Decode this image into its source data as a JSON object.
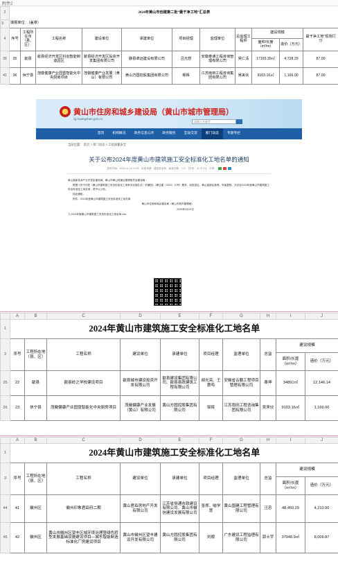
{
  "sheet1": {
    "tab_label": "附件2",
    "title": "2024年黄山市创建第二批“最干净工地”汇总表",
    "unit_label": "填报单位：（盖章）",
    "headers": {
      "seq": "序号",
      "county": "工程所在市（县、区）",
      "project": "工程名称",
      "builder": "建设单位",
      "contractor": "承建单位",
      "pm": "项目经理",
      "supervisor": "监理单位",
      "chief_supervisor": "总监理工程师",
      "scale": "建设规模",
      "area": "面积/长度（m²/m）",
      "cost": "造价（万元）",
      "score": "最干净工地”现场打分"
    },
    "rows": [
      {
        "row_num": "35",
        "seq": "35",
        "county": "歙县",
        "project": "歙县经济开发区科创智能制造园区",
        "builder": "歙县经济开发区投资开发集团有限公司",
        "contractor": "黟县卓远建设有限公司",
        "pm": "吕光想",
        "supervisor": "安徽泰通工程咨询管理有限公司",
        "chief": "吴仁清",
        "area": "17193.39㎡",
        "cost": "4,728.29",
        "score": "87.00"
      },
      {
        "row_num": "41",
        "seq": "36",
        "county": "休宁县",
        "project": "茂徽健康产业园暨智能化中央厨房项目",
        "builder": "茂徽健康产业发展（黄山）有限公司",
        "contractor": "黄山方圆控股集团有限公司",
        "pm": "邹辉",
        "supervisor": "江苏雨田工程咨询集团有限公司",
        "chief": "吴来伙",
        "area": "9103.16㎡",
        "cost": "1,166.00",
        "score": "87.00"
      }
    ],
    "col_letters": [
      "",
      "A",
      "B",
      "C",
      "D",
      "E",
      "F",
      "G",
      "H",
      "I",
      "J",
      "K"
    ]
  },
  "webpage": {
    "site_title": "黄山市住房和城乡建设局（黄山市城市管理局）",
    "site_url": "zjj.huangshan.gov.cn",
    "search_placeholder": "请输入关键字",
    "nav": [
      "首页",
      "机构概况",
      "政务信息公开",
      "政务服务",
      "互动交流",
      "部门动态",
      "专题专栏"
    ],
    "breadcrumb": "当前位置： 首页 > 部门动态 > 工程质量安全",
    "article_title": "关于公布2024年度黄山市建筑施工安全标准化工地名单的通知",
    "meta": "发布时间：2025-01-15 14:55　信息来源：建设安全科　阅读次数：173　【字体：大 中 小】　分享：",
    "paragraphs": [
      "黄山高新技术产业开发区建设局、黄山市黄山风景区管理委员会建设局：",
      "根据《关于印发〈黄山市建筑施工安全标准化工地考评实施办法〉的通知》（黄住建〔2022〕22号）要求，经各县区、黄山高新区推荐、市级复核，共评定2024年度黄山市建筑施工安全标准化工地名单，现予以公布。",
      "特此通知。",
      "附件：2024年度黄山市建筑施工安全标准化工地名单"
    ],
    "signature": "黄山市住房和城乡建设局（黄山市城市管理局）",
    "date": "2025年1月15日",
    "attachment": "2024年度黄山市建筑施工安全标准化工地名单.xlsx"
  },
  "sheet2": {
    "title": "2024年黄山市建筑施工安全标准化工地名单",
    "col_letters": [
      "",
      "A",
      "B",
      "C",
      "D",
      "E",
      "F",
      "G",
      "H",
      "I",
      "J"
    ],
    "headers": {
      "seq": "序号",
      "county": "工程所在地（县、区）",
      "project": "工程名称",
      "builder": "建设单位",
      "contractor": "承建单位",
      "pm": "项目经理",
      "supervisor": "监理单位",
      "chief": "总监",
      "scale": "建设规模",
      "area": "面积/长度（m²/m）",
      "cost": "造价（万元）"
    },
    "rows": [
      {
        "row_num": "25",
        "seq": "22",
        "county": "歙县",
        "project": "歙县岭之学校建设项目",
        "builder": "歙县城市建设投资开发有限公司",
        "contractor": "歙县建设集团有限公司、歙县县政建筑工程有限公司",
        "pm": "胡光亮、王惠鸣",
        "supervisor": "安徽省云鹏工程项目管理有限公司",
        "chief": "桑坤",
        "area": "34891㎡",
        "cost": "12,146.14"
      },
      {
        "row_num": "26",
        "seq": "23",
        "county": "休宁县",
        "project": "茂徽健康产业园暨智能化中央厨房项目",
        "builder": "茂徽健康产业发展（黄山）有限公司",
        "contractor": "黄山方圆控股集团有限公司",
        "pm": "邹辉",
        "supervisor": "江苏雨田工程咨询集团有限公司",
        "chief": "吴来伙",
        "area": "9103.16㎡",
        "cost": "1,166.00"
      }
    ]
  },
  "sheet3": {
    "title": "2024年黄山市建筑施工安全标准化工地名单",
    "col_letters": [
      "",
      "A",
      "B",
      "C",
      "D",
      "E",
      "F",
      "G",
      "H",
      "I",
      "J"
    ],
    "rows": [
      {
        "row_num": "44",
        "seq": "41",
        "county": "徽州区",
        "project": "徽州印象君岳府二期",
        "builder": "黄山君岳房地产开发有限公司",
        "contractor": "江苏省恒通市政建设有限公司、黄山市徽信建设发展有限公司",
        "pm": "张郑、喻学慧",
        "supervisor": "黄山国建工程管理有限公司",
        "chief": "汪忠",
        "area": "48,450.29",
        "cost": "4,210.00"
      },
      {
        "row_num": "45",
        "seq": "42",
        "county": "徽州区",
        "project": "黄山市徽州区望丰区域环境治理暨绿色转型发展基础设施建设项目—城东智能制造标准化厂房建设项目",
        "builder": "黄山市徽州区望丰建设开发有限公司",
        "contractor": "黄山方圆控股集团有限公司",
        "pm": "刘顺",
        "supervisor": "广东建设工程监理有限公司",
        "chief": "郭士宇",
        "area": "37948.9㎡",
        "cost": "8,009.87"
      }
    ]
  }
}
